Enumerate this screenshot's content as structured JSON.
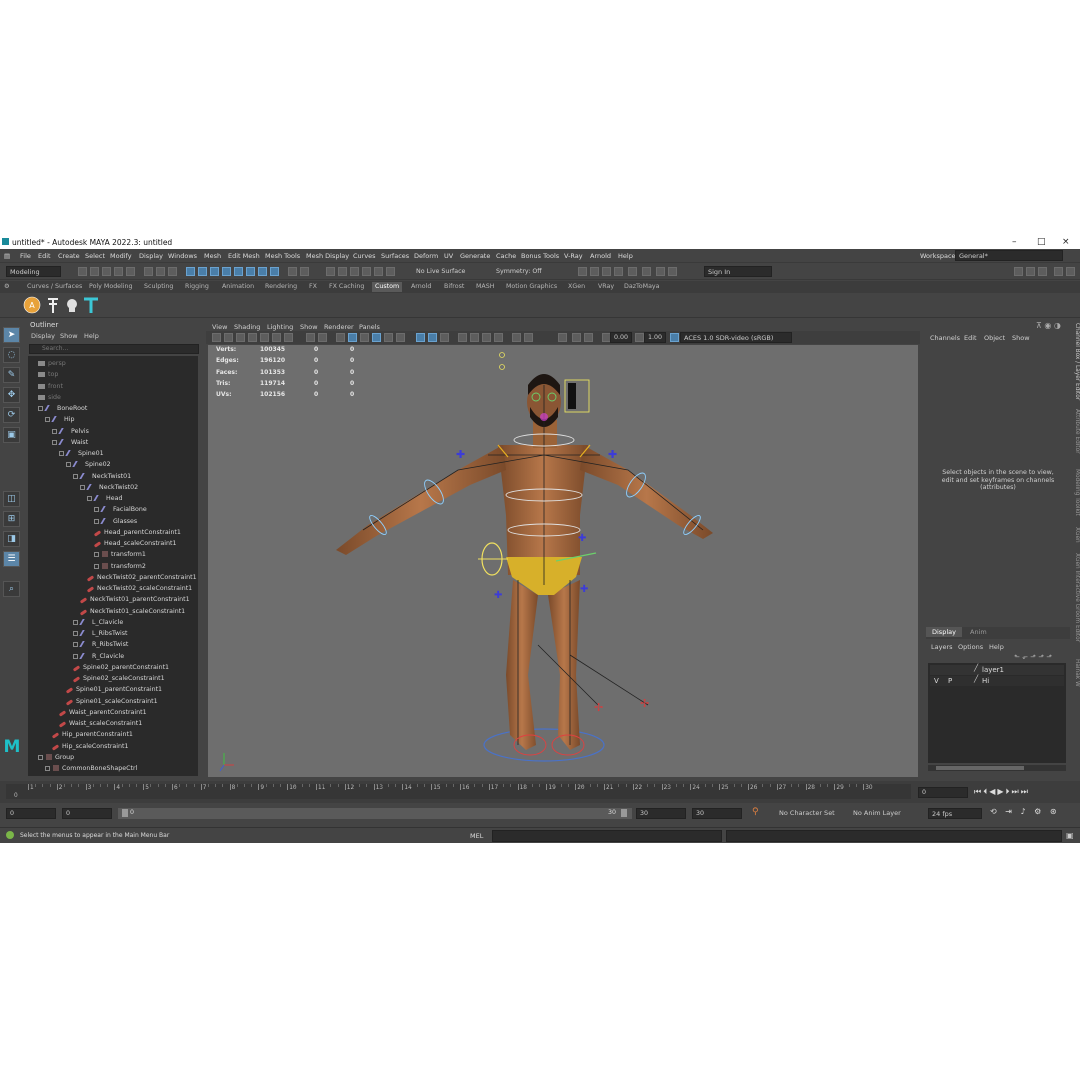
{
  "window": {
    "title": "untitled* - Autodesk MAYA 2022.3: untitled"
  },
  "menus": [
    "File",
    "Edit",
    "Create",
    "Select",
    "Modify",
    "Display",
    "Windows",
    "Mesh",
    "Edit Mesh",
    "Mesh Tools",
    "Mesh Display",
    "Curves",
    "Surfaces",
    "Deform",
    "UV",
    "Generate",
    "Cache",
    "Bonus Tools",
    "V-Ray",
    "Arnold",
    "Help"
  ],
  "workspace": {
    "label": "Workspace:",
    "value": "General*"
  },
  "status_line": {
    "mode": "Modeling",
    "live_surface": "No Live Surface",
    "symmetry": "Symmetry: Off",
    "sign_in": "Sign In"
  },
  "shelf_tabs": [
    "Curves / Surfaces",
    "Poly Modeling",
    "Sculpting",
    "Rigging",
    "Animation",
    "Rendering",
    "FX",
    "FX Caching",
    "Custom",
    "Arnold",
    "Bifrost",
    "MASH",
    "Motion Graphics",
    "XGen",
    "VRay",
    "DazToMaya"
  ],
  "active_shelf": "Custom",
  "outliner": {
    "title": "Outliner",
    "menu": [
      "Display",
      "Show",
      "Help"
    ],
    "search_placeholder": "Search...",
    "rows": [
      {
        "label": "persp",
        "indent": 0,
        "type": "cam",
        "dim": true
      },
      {
        "label": "top",
        "indent": 0,
        "type": "cam",
        "dim": true
      },
      {
        "label": "front",
        "indent": 0,
        "type": "cam",
        "dim": true
      },
      {
        "label": "side",
        "indent": 0,
        "type": "cam",
        "dim": true
      },
      {
        "label": "BoneRoot",
        "indent": 0,
        "type": "joint"
      },
      {
        "label": "Hip",
        "indent": 1,
        "type": "joint"
      },
      {
        "label": "Pelvis",
        "indent": 2,
        "type": "joint"
      },
      {
        "label": "Waist",
        "indent": 2,
        "type": "joint"
      },
      {
        "label": "Spine01",
        "indent": 3,
        "type": "joint"
      },
      {
        "label": "Spine02",
        "indent": 4,
        "type": "joint"
      },
      {
        "label": "NeckTwist01",
        "indent": 5,
        "type": "joint"
      },
      {
        "label": "NeckTwist02",
        "indent": 6,
        "type": "joint"
      },
      {
        "label": "Head",
        "indent": 7,
        "type": "joint"
      },
      {
        "label": "FacialBone",
        "indent": 8,
        "type": "joint"
      },
      {
        "label": "Glasses",
        "indent": 8,
        "type": "joint"
      },
      {
        "label": "Head_parentConstraint1",
        "indent": 8,
        "type": "cons"
      },
      {
        "label": "Head_scaleConstraint1",
        "indent": 8,
        "type": "cons"
      },
      {
        "label": "transform1",
        "indent": 8,
        "type": "xform"
      },
      {
        "label": "transform2",
        "indent": 8,
        "type": "xform"
      },
      {
        "label": "NeckTwist02_parentConstraint1",
        "indent": 7,
        "type": "cons"
      },
      {
        "label": "NeckTwist02_scaleConstraint1",
        "indent": 7,
        "type": "cons"
      },
      {
        "label": "NeckTwist01_parentConstraint1",
        "indent": 6,
        "type": "cons"
      },
      {
        "label": "NeckTwist01_scaleConstraint1",
        "indent": 6,
        "type": "cons"
      },
      {
        "label": "L_Clavicle",
        "indent": 5,
        "type": "joint"
      },
      {
        "label": "L_RibsTwist",
        "indent": 5,
        "type": "joint"
      },
      {
        "label": "R_RibsTwist",
        "indent": 5,
        "type": "joint"
      },
      {
        "label": "R_Clavicle",
        "indent": 5,
        "type": "joint"
      },
      {
        "label": "Spine02_parentConstraint1",
        "indent": 5,
        "type": "cons"
      },
      {
        "label": "Spine02_scaleConstraint1",
        "indent": 5,
        "type": "cons"
      },
      {
        "label": "Spine01_parentConstraint1",
        "indent": 4,
        "type": "cons"
      },
      {
        "label": "Spine01_scaleConstraint1",
        "indent": 4,
        "type": "cons"
      },
      {
        "label": "Waist_parentConstraint1",
        "indent": 3,
        "type": "cons"
      },
      {
        "label": "Waist_scaleConstraint1",
        "indent": 3,
        "type": "cons"
      },
      {
        "label": "Hip_parentConstraint1",
        "indent": 2,
        "type": "cons"
      },
      {
        "label": "Hip_scaleConstraint1",
        "indent": 2,
        "type": "cons"
      },
      {
        "label": "Group",
        "indent": 0,
        "type": "xform"
      },
      {
        "label": "CommonBoneShapeCtrl",
        "indent": 1,
        "type": "xform"
      }
    ]
  },
  "viewport": {
    "menu": [
      "View",
      "Shading",
      "Lighting",
      "Show",
      "Renderer",
      "Panels"
    ],
    "field_a": "0.00",
    "field_b": "1.00",
    "color_space": "ACES 1.0 SDR-video (sRGB)",
    "hud": [
      {
        "label": "Verts:",
        "a": "100345",
        "b": "0",
        "c": "0"
      },
      {
        "label": "Edges:",
        "a": "196120",
        "b": "0",
        "c": "0"
      },
      {
        "label": "Faces:",
        "a": "101353",
        "b": "0",
        "c": "0"
      },
      {
        "label": "Tris:",
        "a": "119714",
        "b": "0",
        "c": "0"
      },
      {
        "label": "UVs:",
        "a": "102156",
        "b": "0",
        "c": "0"
      }
    ]
  },
  "channel_box": {
    "menu": [
      "Channels",
      "Edit",
      "Object",
      "Show"
    ],
    "empty_message": "Select objects in the scene to view, edit and set keyframes on channels (attributes)"
  },
  "layer_editor": {
    "tabs": [
      "Display",
      "Anim"
    ],
    "menu": [
      "Layers",
      "Options",
      "Help"
    ],
    "layers": [
      {
        "v": "",
        "p": "",
        "name": "layer1"
      },
      {
        "v": "V",
        "p": "P",
        "name": "Hi"
      }
    ]
  },
  "side_tabs": [
    "Channel Box / Layer Editor",
    "Attribute Editor",
    "Modeling Toolkit",
    "XGen",
    "XGen Interactive Groom Editor",
    "Hainak W"
  ],
  "timeline": {
    "ticks": [
      "1",
      "2",
      "3",
      "4",
      "5",
      "6",
      "7",
      "8",
      "9",
      "10",
      "11",
      "12",
      "13",
      "14",
      "15",
      "16",
      "17",
      "18",
      "19",
      "20",
      "21",
      "22",
      "23",
      "24",
      "25",
      "26",
      "27",
      "28",
      "29",
      "30"
    ],
    "current_frame": "0",
    "current_frame_field": "0"
  },
  "range": {
    "start": "0",
    "anim_start": "0",
    "slider_start": "0",
    "slider_end": "30",
    "anim_end": "30",
    "end": "30",
    "character_set": "No Character Set",
    "anim_layer": "No Anim Layer",
    "fps": "24 fps"
  },
  "command_line": {
    "language": "MEL",
    "help_text": "Select the menus to appear in the Main Menu Bar"
  }
}
